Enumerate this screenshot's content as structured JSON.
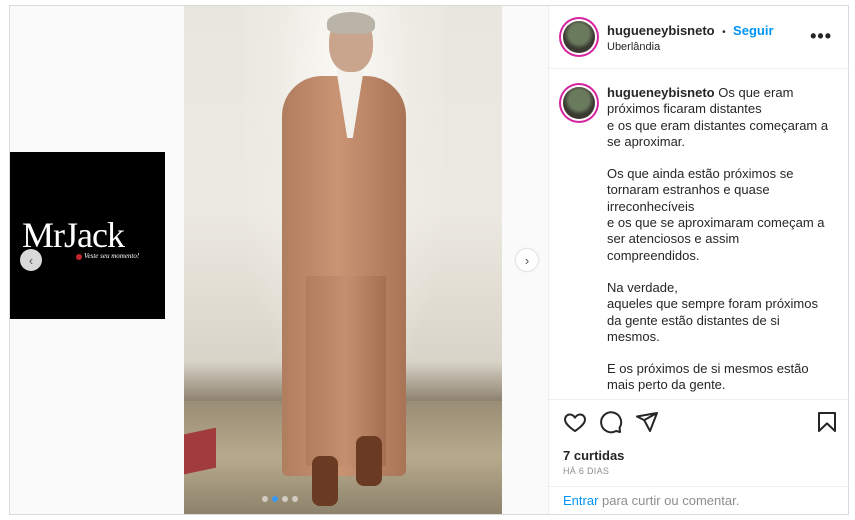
{
  "post": {
    "username": "hugueneybisneto",
    "separator": "•",
    "follow_label": "Seguir",
    "location": "Uberlândia",
    "more_label": "•••"
  },
  "media": {
    "left_thumb_logo": "MrJack",
    "left_thumb_tagline": "Veste seu momento!",
    "prev_icon": "‹",
    "next_icon": "›",
    "slide_count": 4,
    "active_slide": 2
  },
  "caption": {
    "username": "hugueneybisneto",
    "paragraphs": [
      "Os que eram próximos ficaram distantes\ne os que eram distantes começaram a se aproximar.",
      "Os que ainda estão próximos se tornaram estranhos e quase irreconhecíveis\ne os que se aproximaram começam a ser atenciosos e assim compreendidos.",
      "Na verdade,\naqueles que sempre foram próximos da gente estão distantes de si mesmos.",
      "E os próximos de si mesmos estão mais perto da gente."
    ]
  },
  "actions": {
    "icons": [
      "heart-icon",
      "comment-icon",
      "share-icon",
      "bookmark-icon"
    ],
    "likes": "7 curtidas",
    "time": "HÁ 6 DIAS"
  },
  "add_comment": {
    "link_label": "Entrar",
    "rest_label": " para curtir ou comentar."
  },
  "colors": {
    "accent": "#0095f6",
    "border": "#dbdbdb",
    "muted": "#8e8e8e"
  }
}
